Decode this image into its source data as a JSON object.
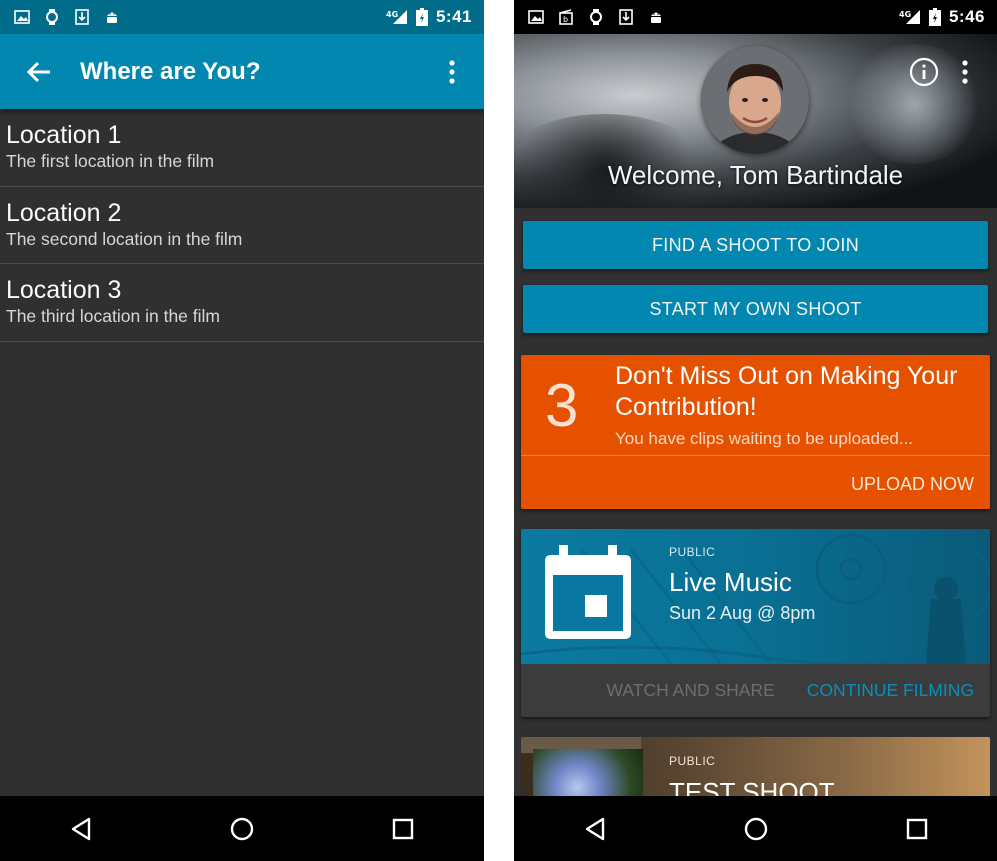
{
  "left_screen": {
    "status_bar": {
      "time": "5:41",
      "network": "4G"
    },
    "app_bar": {
      "title": "Where are You?"
    },
    "locations": [
      {
        "title": "Location 1",
        "subtitle": "The first location in the film"
      },
      {
        "title": "Location 2",
        "subtitle": "The second location in the film"
      },
      {
        "title": "Location 3",
        "subtitle": "The third location in the film"
      }
    ]
  },
  "right_screen": {
    "status_bar": {
      "time": "5:46",
      "network": "4G"
    },
    "header": {
      "welcome": "Welcome, Tom Bartindale"
    },
    "buttons": {
      "find": "FIND A SHOOT TO JOIN",
      "start": "START MY OWN SHOOT"
    },
    "upload_card": {
      "count": "3",
      "title": "Don't Miss Out on Making Your Contribution!",
      "subtitle": "You have clips waiting to be uploaded...",
      "action": "UPLOAD NOW"
    },
    "shoots": [
      {
        "tag": "PUBLIC",
        "title": "Live Music",
        "date": "Sun 2 Aug @ 8pm",
        "action_watch": "WATCH AND SHARE",
        "action_continue": "CONTINUE FILMING"
      },
      {
        "tag": "PUBLIC",
        "title": "TEST SHOOT"
      }
    ]
  },
  "colors": {
    "primary": "#0288b0",
    "primary_dark": "#016b8a",
    "accent_orange": "#e65100",
    "background": "#303030",
    "link": "#0a8fbb"
  },
  "icons": [
    "image-icon",
    "watch-icon",
    "download-icon",
    "android-icon",
    "signal-icon",
    "battery-icon",
    "back-arrow-icon",
    "more-vert-icon",
    "info-icon",
    "calendar-icon",
    "nav-back-icon",
    "nav-home-icon",
    "nav-recents-icon"
  ]
}
